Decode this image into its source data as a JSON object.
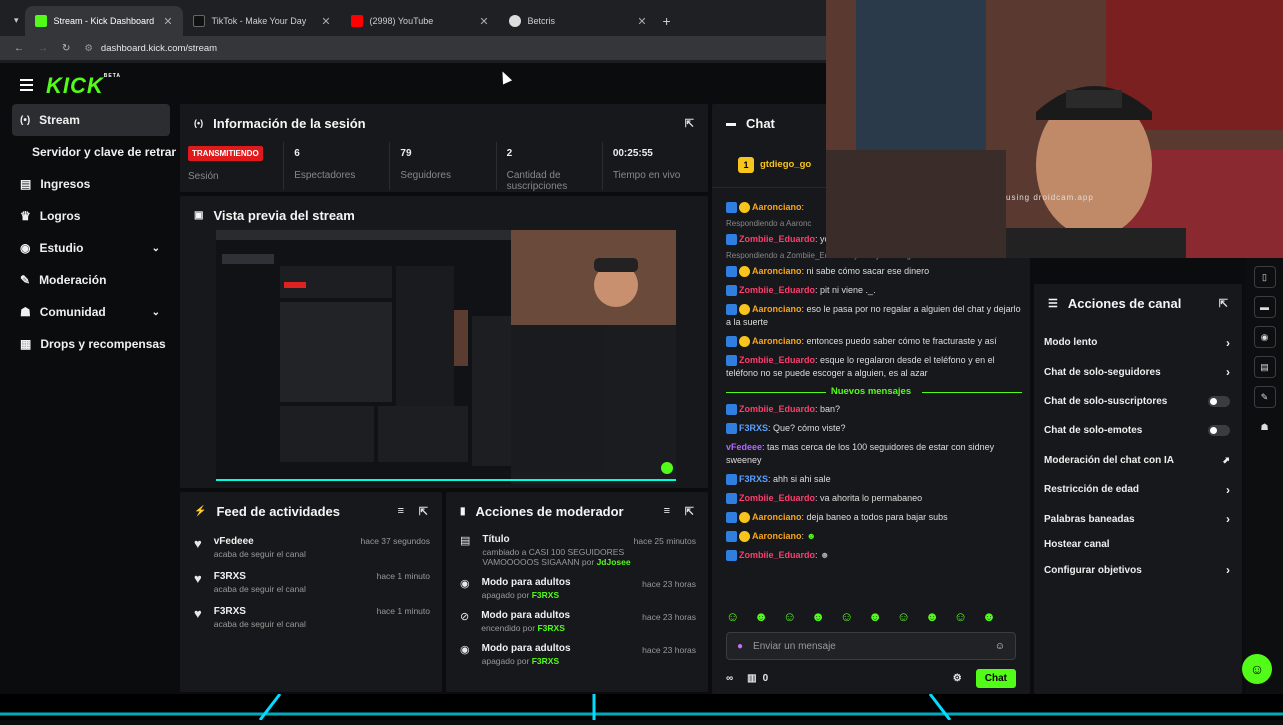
{
  "browser": {
    "tabs": [
      {
        "label": "Stream - Kick Dashboard",
        "color": "#53fc18"
      },
      {
        "label": "TikTok - Make Your Day",
        "color": "#111111"
      },
      {
        "label": "(2998) YouTube",
        "color": "#ff0000"
      },
      {
        "label": "Betcris",
        "color": "#dddddd"
      }
    ],
    "url": "dashboard.kick.com/stream"
  },
  "brand": {
    "logo": "KICK",
    "beta": "BETA",
    "accent": "#53fc18"
  },
  "sidebar": {
    "items": [
      {
        "label": "Stream",
        "icon": "broadcast-icon"
      },
      {
        "label": "Servidor y clave de retransm",
        "icon": ""
      },
      {
        "label": "Ingresos",
        "icon": "coins-icon"
      },
      {
        "label": "Logros",
        "icon": "trophy-icon"
      },
      {
        "label": "Estudio",
        "icon": "palette-icon"
      },
      {
        "label": "Moderación",
        "icon": "wrench-icon"
      },
      {
        "label": "Comunidad",
        "icon": "people-icon"
      },
      {
        "label": "Drops y recompensas",
        "icon": "gift-icon"
      }
    ]
  },
  "session": {
    "title": "Información de la sesión",
    "status": "TRANSMITIENDO",
    "status_label": "Sesión",
    "stats": [
      {
        "value": "6",
        "label": "Espectadores"
      },
      {
        "value": "79",
        "label": "Seguidores"
      },
      {
        "value": "2",
        "label": "Cantidad de suscripciones"
      },
      {
        "value": "00:25:55",
        "label": "Tiempo en vivo"
      }
    ]
  },
  "preview": {
    "title": "Vista previa del stream"
  },
  "feed": {
    "title": "Feed de actividades",
    "items": [
      {
        "user": "vFedeee",
        "action": "acaba de seguir el canal",
        "time": "hace 37 segundos"
      },
      {
        "user": "F3RXS",
        "action": "acaba de seguir el canal",
        "time": "hace 1 minuto"
      },
      {
        "user": "F3RXS",
        "action": "acaba de seguir el canal",
        "time": "hace 1 minuto"
      }
    ]
  },
  "modactions": {
    "title": "Acciones de moderador",
    "items": [
      {
        "title": "Título",
        "desc": "cambiado a CASI 100 SEGUIDORES VAMOOOOOS SIGAANN por",
        "by": "JdJosee",
        "time": "hace 25 minutos"
      },
      {
        "title": "Modo para adultos",
        "desc": "apagado por",
        "by": "F3RXS",
        "time": "hace 23 horas"
      },
      {
        "title": "Modo para adultos",
        "desc": "encendido por",
        "by": "F3RXS",
        "time": "hace 23 horas"
      },
      {
        "title": "Modo para adultos",
        "desc": "apagado por",
        "by": "F3RXS",
        "time": "hace 23 horas"
      }
    ]
  },
  "chat": {
    "title": "Chat",
    "pinned_user": "gtdiego_go",
    "pinned_amount": "1",
    "new_messages_label": "Nuevos mensajes",
    "messages_before": [
      {
        "user": "Aaronciano",
        "color": "#f7a51c",
        "text": ""
      },
      {
        "user": "Respondiendo a Aaronc",
        "color": "#888888",
        "text": ""
      },
      {
        "user": "Zombiie_Eduardo",
        "color": "#ff3d6e",
        "text": "yo"
      },
      {
        "user": "Respondiendo a Zombiie_Eduardo: ya muy duro algo",
        "color": "#888888",
        "text": ""
      },
      {
        "user": "Aaronciano",
        "color": "#f7a51c",
        "text": "ni sabe cómo sacar ese dinero"
      },
      {
        "user": "Zombiie_Eduardo",
        "color": "#ff3d6e",
        "text": "pit ni viene ._."
      },
      {
        "user": "Aaronciano",
        "color": "#f7a51c",
        "text": "eso le pasa por no regalar a alguien del chat y dejarlo a la suerte"
      },
      {
        "user": "Aaronciano",
        "color": "#f7a51c",
        "text": "entonces puedo saber cómo te fracturaste y así"
      },
      {
        "user": "Zombiie_Eduardo",
        "color": "#ff3d6e",
        "text": "esque lo regalaron desde el teléfono y en el teléfono no se puede escoger a alguien, es al azar"
      }
    ],
    "messages_after": [
      {
        "user": "Zombiie_Eduardo",
        "color": "#ff3d6e",
        "text": "ban?"
      },
      {
        "user": "F3RXS",
        "color": "#5aa0ff",
        "text": "Que? cómo viste?"
      },
      {
        "user": "vFedeee",
        "color": "#b066ff",
        "text": "tas mas cerca de los 100 seguidores de estar con sidney sweeney"
      },
      {
        "user": "F3RXS",
        "color": "#5aa0ff",
        "text": "ahh si ahi sale"
      },
      {
        "user": "Zombiie_Eduardo",
        "color": "#ff3d6e",
        "text": "va ahorita lo permabaneo"
      },
      {
        "user": "Aaronciano",
        "color": "#f7a51c",
        "text": "deja baneo a todos para bajar subs"
      },
      {
        "user": "Aaronciano",
        "color": "#f7a51c",
        "text": ""
      },
      {
        "user": "Zombiie_Eduardo",
        "color": "#ff3d6e",
        "text": ""
      }
    ],
    "input_placeholder": "Enviar un mensaje",
    "viewer_count": "0",
    "send_label": "Chat"
  },
  "channel_actions": {
    "title": "Acciones de canal",
    "items": [
      {
        "label": "Modo lento",
        "control": "chevron"
      },
      {
        "label": "Chat de solo-seguidores",
        "control": "chevron"
      },
      {
        "label": "Chat de solo-suscriptores",
        "control": "toggle"
      },
      {
        "label": "Chat de solo-emotes",
        "control": "toggle"
      },
      {
        "label": "Moderación del chat con IA",
        "control": "chart"
      },
      {
        "label": "Restricción de edad",
        "control": "chevron"
      },
      {
        "label": "Palabras baneadas",
        "control": "chevron"
      },
      {
        "label": "Hostear canal",
        "control": "none"
      },
      {
        "label": "Configurar objetivos",
        "control": "chevron"
      }
    ]
  },
  "webcam": {
    "watermark": "using droidcam.app"
  }
}
